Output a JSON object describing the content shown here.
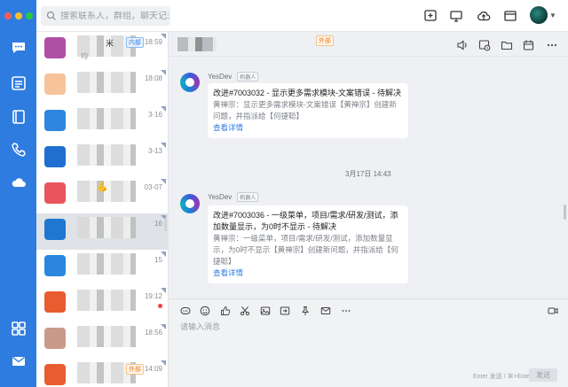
{
  "window": {
    "traffic_lights": [
      "#ff5f57",
      "#febc2e",
      "#28c840"
    ]
  },
  "rail": {
    "items": [
      {
        "name": "messages",
        "icon": "chat-icon"
      },
      {
        "name": "workbench",
        "icon": "grid-card-icon"
      },
      {
        "name": "docs",
        "icon": "book-icon"
      },
      {
        "name": "calls",
        "icon": "phone-icon"
      },
      {
        "name": "cloud",
        "icon": "cloud-icon"
      },
      {
        "name": "apps",
        "icon": "apps-icon"
      },
      {
        "name": "mail",
        "icon": "mail-icon"
      }
    ],
    "accent": "#2e7ce0"
  },
  "search": {
    "placeholder": "搜索联系人，群组，聊天记录"
  },
  "toolbar": {
    "icons": [
      "add-icon",
      "screen-share-icon",
      "cloud-upload-icon",
      "window-icon"
    ]
  },
  "conversations": [
    {
      "avatar": "#b04fa6",
      "time": "18:59",
      "tag": "内部",
      "title_fragment": "米",
      "sub_fragment": "均"
    },
    {
      "avatar": "#f6c39b",
      "time": "18:08"
    },
    {
      "avatar": "#2e86de",
      "time": "3-16"
    },
    {
      "avatar": "#1f6fd1",
      "time": "3-13"
    },
    {
      "avatar": "#e8555d",
      "time": "03-07",
      "emoji": "💪"
    },
    {
      "avatar": "#2077d1",
      "time": "16",
      "active": true
    },
    {
      "avatar": "#2a86de",
      "time": "15"
    },
    {
      "avatar": "#e85d2f",
      "time": "19:12",
      "unread": true
    },
    {
      "avatar": "#c99a8a",
      "time": "18:56"
    },
    {
      "avatar": "#e85d2f",
      "time": "14:09",
      "tag": "外部"
    }
  ],
  "chat": {
    "header_tag": "外部",
    "header_icons": [
      "speaker-icon",
      "clock-icon",
      "folder-icon",
      "calendar-icon",
      "more-icon"
    ],
    "messages": [
      {
        "sender": "YesDev",
        "robot_label": "机器人",
        "title": "改进#7003032 - 显示更多需求模块-文案错误 - 待解决",
        "desc": "黄禅宗：显示更多需求模块-文案错误【黄禅宗】创建新问题，并指派给【何捷聪】",
        "link": "查看详情"
      },
      {
        "sender": "YesDev",
        "robot_label": "机器人",
        "title": "改进#7003036 - 一级菜单，项目/需求/研发/测试，添加数量显示，为0时不显示 - 待解决",
        "desc": "黄禅宗：一级菜单，项目/需求/研发/测试，添加数量显示，为0时不显示【黄禅宗】创建新问题，并指派给【何捷聪】",
        "link": "查看详情"
      }
    ],
    "daystamp": "3月17日 14:43"
  },
  "composer": {
    "placeholder": "请输入消息",
    "hint": "Enter 发送 / ⌘+Enter 换行",
    "send_label": "发送",
    "icons": [
      "gif-icon",
      "emoji-icon",
      "thumbs-up-icon",
      "scissors-icon",
      "image-icon",
      "forward-icon",
      "pin-icon",
      "mail-icon",
      "more-icon",
      "video-icon"
    ]
  }
}
